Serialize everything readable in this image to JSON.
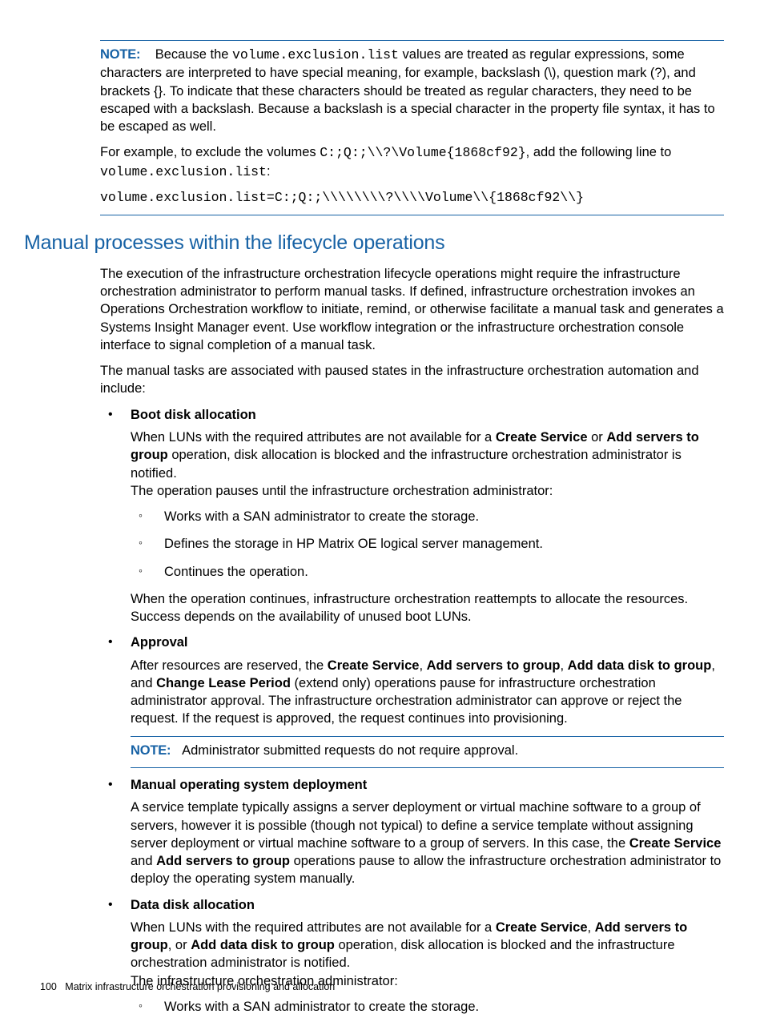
{
  "note1": {
    "label": "NOTE:",
    "para1_pre": "Because the ",
    "para1_code": "volume.exclusion.list",
    "para1_post": " values are treated as regular expressions, some characters are interpreted to have special meaning, for example, backslash (\\), question mark (?), and brackets {}. To indicate that these characters should be treated as regular characters, they need to be escaped with a backslash. Because a backslash is a special character in the property file syntax, it has to be escaped as well.",
    "para2_pre": "For example, to exclude the volumes ",
    "para2_code": "C:;Q:;\\\\?\\Volume{1868cf92}",
    "para2_mid": ", add the following line to ",
    "para2_code2": "volume.exclusion.list",
    "para2_post": ":",
    "codeblock": "volume.exclusion.list=C:;Q:;\\\\\\\\\\\\\\\\?\\\\\\\\Volume\\\\{1868cf92\\\\}"
  },
  "section_title": "Manual processes within the lifecycle operations",
  "intro1": "The execution of the infrastructure orchestration lifecycle operations might require the infrastructure orchestration administrator to perform manual tasks. If defined, infrastructure orchestration invokes an Operations Orchestration workflow to initiate, remind, or otherwise facilitate a manual task and generates a Systems Insight Manager event. Use workflow integration or the infrastructure orchestration console interface to signal completion of a manual task.",
  "intro2": "The manual tasks are associated with paused states in the infrastructure orchestration automation and include:",
  "items": [
    {
      "title": "Boot disk allocation",
      "p1_pre": "When LUNs with the required attributes are not available for a ",
      "p1_b1": "Create Service",
      "p1_mid": " or ",
      "p1_b2": "Add servers to group",
      "p1_post": " operation, disk allocation is blocked and the infrastructure orchestration administrator is notified.",
      "p2": "The operation pauses until the infrastructure orchestration administrator:",
      "sub": [
        "Works with a SAN administrator to create the storage.",
        "Defines the storage in HP Matrix OE logical server management.",
        "Continues the operation."
      ],
      "p3": "When the operation continues, infrastructure orchestration reattempts to allocate the resources. Success depends on the availability of unused boot LUNs."
    },
    {
      "title": "Approval",
      "p1_pre": "After resources are reserved, the ",
      "p1_b1": "Create Service",
      "p1_s1": ", ",
      "p1_b2": "Add servers to group",
      "p1_s2": ", ",
      "p1_b3": "Add data disk to group",
      "p1_s3": ", and ",
      "p1_b4": "Change Lease Period",
      "p1_post": " (extend only) operations pause for infrastructure orchestration administrator approval. The infrastructure orchestration administrator can approve or reject the request. If the request is approved, the request continues into provisioning.",
      "note_label": "NOTE:",
      "note_text": "Administrator submitted requests do not require approval."
    },
    {
      "title": "Manual operating system deployment",
      "p1_pre": "A service template typically assigns a server deployment or virtual machine software to a group of servers, however it is possible (though not typical) to define a service template without assigning server deployment or virtual machine software to a group of servers. In this case, the ",
      "p1_b1": "Create Service",
      "p1_mid": " and ",
      "p1_b2": "Add servers to group",
      "p1_post": " operations pause to allow the infrastructure orchestration administrator to deploy the operating system manually."
    },
    {
      "title": "Data disk allocation",
      "p1_pre": "When LUNs with the required attributes are not available for a ",
      "p1_b1": "Create Service",
      "p1_s1": ", ",
      "p1_b2": "Add servers to group",
      "p1_s2": ", or ",
      "p1_b3": "Add data disk to group",
      "p1_post": " operation, disk allocation is blocked and the infrastructure orchestration administrator is notified.",
      "p2": "The infrastructure orchestration administrator:",
      "sub": [
        "Works with a SAN administrator to create the storage."
      ]
    }
  ],
  "footer": {
    "pagenum": "100",
    "text": "Matrix infrastructure orchestration provisioning and allocation"
  }
}
